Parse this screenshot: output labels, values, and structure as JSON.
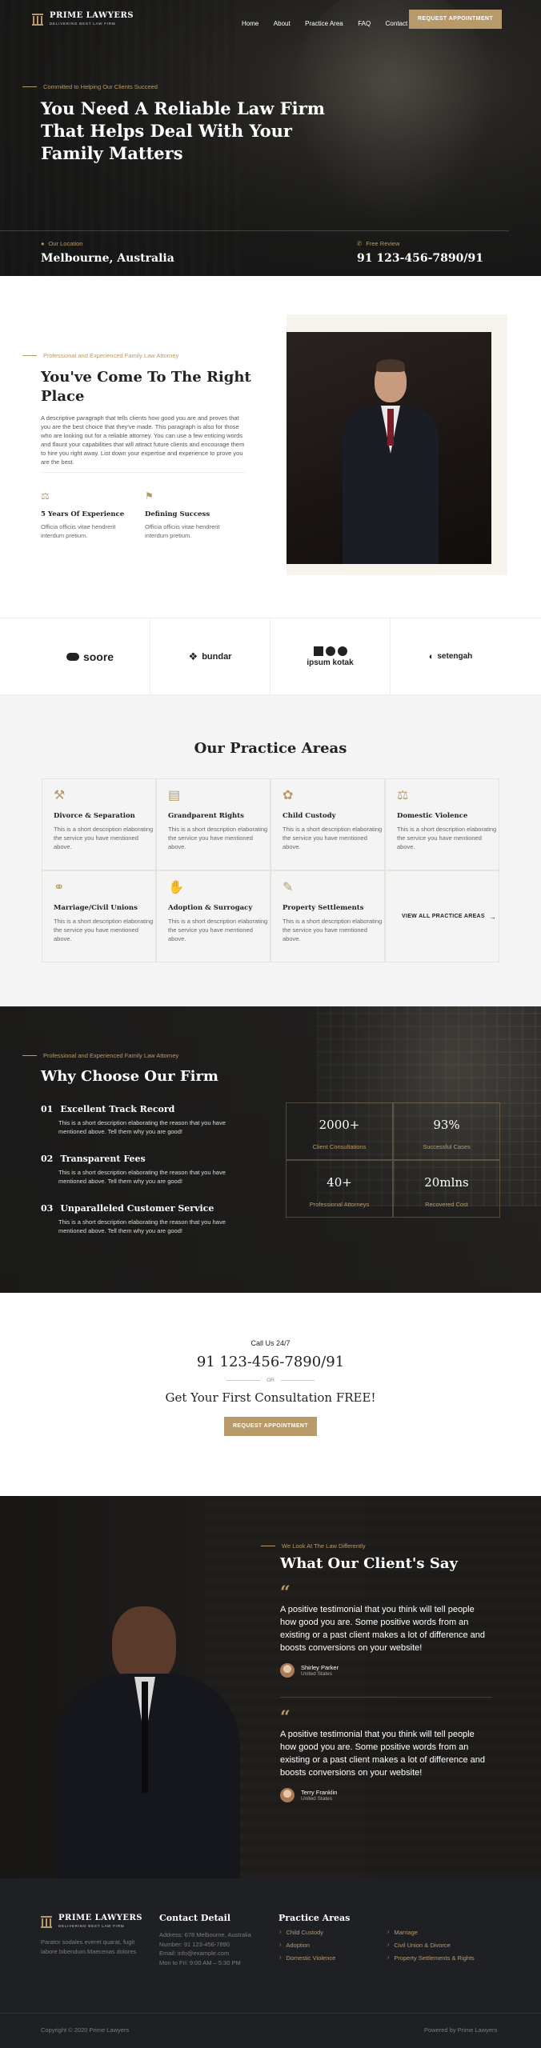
{
  "header": {
    "logo_name": "PRIME LAWYERS",
    "logo_tag": "DELIVERING BEST LAW FIRM",
    "nav": [
      "Home",
      "About",
      "Practice Area",
      "FAQ",
      "Contact"
    ],
    "cta": "REQUEST APPOINTMENT"
  },
  "hero": {
    "eyebrow": "Committed to Helping Our Clients Succeed",
    "title_l1": "You Need A Reliable Law Firm",
    "title_l2": "That Helps Deal With Your",
    "title_l3": "Family Matters",
    "loc_label": "Our Location",
    "loc_value": "Melbourne, Australia",
    "phone_label": "Free Review",
    "phone_value": "91 123-456-7890/91"
  },
  "about": {
    "eyebrow": "Professional and Experienced Family Law Attorney",
    "title_l1": "You've Come To The Right",
    "title_l2": "Place",
    "paragraph": "A descriptive paragraph that tells clients how good you are and proves that you are the best choice that they've made. This paragraph is also for those who are looking out for a reliable attorney. You can use a few enticing words and flaunt your capabilities that will attract future clients and encourage them to hire you right away. List down your expertise and experience to prove you are the best.",
    "features": [
      {
        "icon": "scale-icon",
        "title": "5 Years Of Experience",
        "text": "Officia officiis vitae hendrerit interdum pretium."
      },
      {
        "icon": "flag-icon",
        "title": "Defining Success",
        "text": "Officia officiis vitae hendrerit interdum pretium."
      }
    ]
  },
  "clients": [
    "soore",
    "bundar",
    "ipsum kotak",
    "setengah"
  ],
  "practice": {
    "title": "Our Practice Areas",
    "cards": [
      {
        "icon": "gavel-icon",
        "title": "Divorce & Separation",
        "text": "This is a short description elaborating the service you have mentioned above."
      },
      {
        "icon": "document-icon",
        "title": "Grandparent Rights",
        "text": "This is a short description elaborating the service you have mentioned above."
      },
      {
        "icon": "footprints-icon",
        "title": "Child Custody",
        "text": "This is a short description elaborating the service you have mentioned above."
      },
      {
        "icon": "scales-icon",
        "title": "Domestic Violence",
        "text": "This is a short description elaborating the service you have mentioned above."
      },
      {
        "icon": "rings-icon",
        "title": "Marriage/Civil Unions",
        "text": "This is a short description elaborating the service you have mentioned above."
      },
      {
        "icon": "handshake-icon",
        "title": "Adoption & Surrogacy",
        "text": "This is a short description elaborating the service you have mentioned above."
      },
      {
        "icon": "contract-icon",
        "title": "Property Settlements",
        "text": "This is a short description elaborating the service you have mentioned above."
      }
    ],
    "view_all": "VIEW ALL PRACTICE AREAS"
  },
  "why": {
    "eyebrow": "Professional and Experienced Family Law Attorney",
    "title": "Why Choose Our Firm",
    "items": [
      {
        "num": "01",
        "title": "Excellent Track Record",
        "text": "This is a short description elaborating the reason that you have mentioned above. Tell them why you are good!"
      },
      {
        "num": "02",
        "title": "Transparent Fees",
        "text": "This is a short description elaborating the reason that you have mentioned above. Tell them why you are good!"
      },
      {
        "num": "03",
        "title": "Unparalleled Customer Service",
        "text": "This is a short description elaborating the reason that you have mentioned above. Tell them why you are good!"
      }
    ],
    "stats": [
      {
        "value": "2000+",
        "label": "Client Consultations"
      },
      {
        "value": "93%",
        "label": "Successful Cases"
      },
      {
        "value": "40+",
        "label": "Professional Attorneys"
      },
      {
        "value": "20mlns",
        "label": "Recovered Cost"
      }
    ]
  },
  "call": {
    "label": "Call Us 24/7",
    "phone": "91 123-456-7890/91",
    "or": "OR",
    "consult": "Get Your First Consultation FREE!",
    "cta": "REQUEST APPOINTMENT"
  },
  "testimonials": {
    "eyebrow": "We Look At The Law Differently",
    "title": "What Our Client's Say",
    "items": [
      {
        "text": "A positive testimonial that you think will tell people how good you are. Some positive words from an existing or a past client makes a lot of difference and boosts conversions on your website!",
        "name": "Shirley Parker",
        "location": "United States"
      },
      {
        "text": "A positive testimonial that you think will tell people how good you are. Some positive words from an existing or a past client makes a lot of difference and boosts conversions on your website!",
        "name": "Terry Franklin",
        "location": "United States"
      }
    ]
  },
  "footer": {
    "logo_name": "PRIME LAWYERS",
    "logo_tag": "DELIVERING BEST LAW FIRM",
    "about": "Parator sodales everet quarat, fugit labore bibendum.Maecenas dolores",
    "contact_title": "Contact Detail",
    "contact_lines": [
      "Address: 678 Melbourne, Australia",
      "Number: 91 123-456-7890",
      "Email: info@example.com",
      "Mon to Fri: 9:00 AM – 5:30 PM"
    ],
    "practice_title": "Practice Areas",
    "practice_col1": [
      "Child Custody",
      "Adoption",
      "Domestic Violence"
    ],
    "practice_col2": [
      "Marriage",
      "Civil Union & Divorce",
      "Property Settlements & Rights"
    ],
    "copyright": "Copyright © 2020 Prime Lawyers",
    "powered": "Powered by Prime Lawyers"
  },
  "colors": {
    "accent": "#b89a6a",
    "dark": "#1f2023"
  }
}
